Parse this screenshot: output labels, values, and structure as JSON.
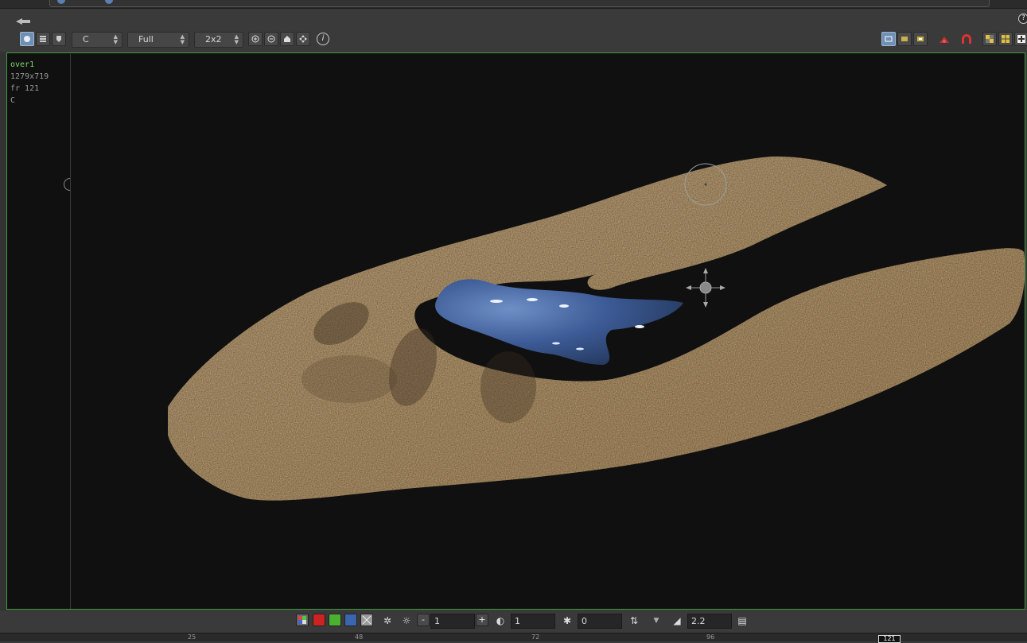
{
  "toolbar": {
    "channel": "C",
    "resolution": "Full",
    "tile": "2x2",
    "info_label": "i"
  },
  "viewport": {
    "node_name": "over1",
    "image_size": "1279x719",
    "frame": "fr 121",
    "plane": "C"
  },
  "bottombar": {
    "exposure_value": "1",
    "gamma_value": "1",
    "brightness_value": "0",
    "lut_value": "2.2",
    "minus_label": "-",
    "plus_label": "+"
  },
  "timeline": {
    "ticks": [
      "25",
      "48",
      "72",
      "96"
    ],
    "current_frame": "121"
  },
  "help_label": "?",
  "colors": {
    "viewport_border": "#3f9a3f",
    "sand": "#cfae7f",
    "water": "#3d5f9a",
    "node_name": "#7bd96a"
  }
}
